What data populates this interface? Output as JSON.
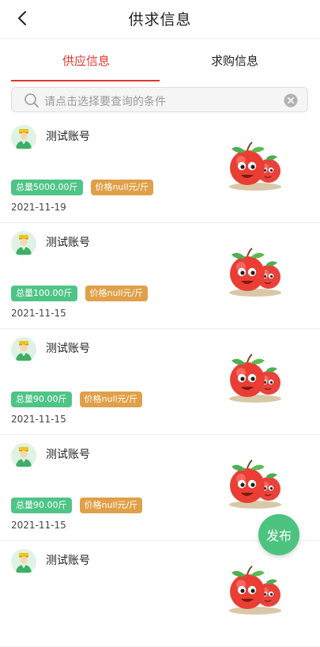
{
  "header": {
    "title": "供求信息"
  },
  "tabs": [
    {
      "label": "供应信息",
      "active": true
    },
    {
      "label": "求购信息",
      "active": false
    }
  ],
  "search": {
    "placeholder": "请点击选择要查询的条件"
  },
  "items": [
    {
      "name": "测试账号",
      "total": "总量5000.00斤",
      "price": "价格null元/斤",
      "date": "2021-11-19"
    },
    {
      "name": "测试账号",
      "total": "总量100.00斤",
      "price": "价格null元/斤",
      "date": "2021-11-15"
    },
    {
      "name": "测试账号",
      "total": "总量90.00斤",
      "price": "价格null元/斤",
      "date": "2021-11-15"
    },
    {
      "name": "测试账号",
      "total": "总量90.00斤",
      "price": "价格null元/斤",
      "date": "2021-11-15"
    },
    {
      "name": "测试账号"
    }
  ],
  "fab": {
    "label": "发布"
  },
  "colors": {
    "accent": "#e3372a",
    "green": "#4fc487",
    "orange": "#e0a049",
    "fab": "#4cc37f"
  },
  "icons": {
    "back": "chevron-left-icon",
    "search": "search-icon",
    "clear": "clear-icon",
    "avatar": "user-avatar-icon",
    "product": "apple-product-image"
  }
}
